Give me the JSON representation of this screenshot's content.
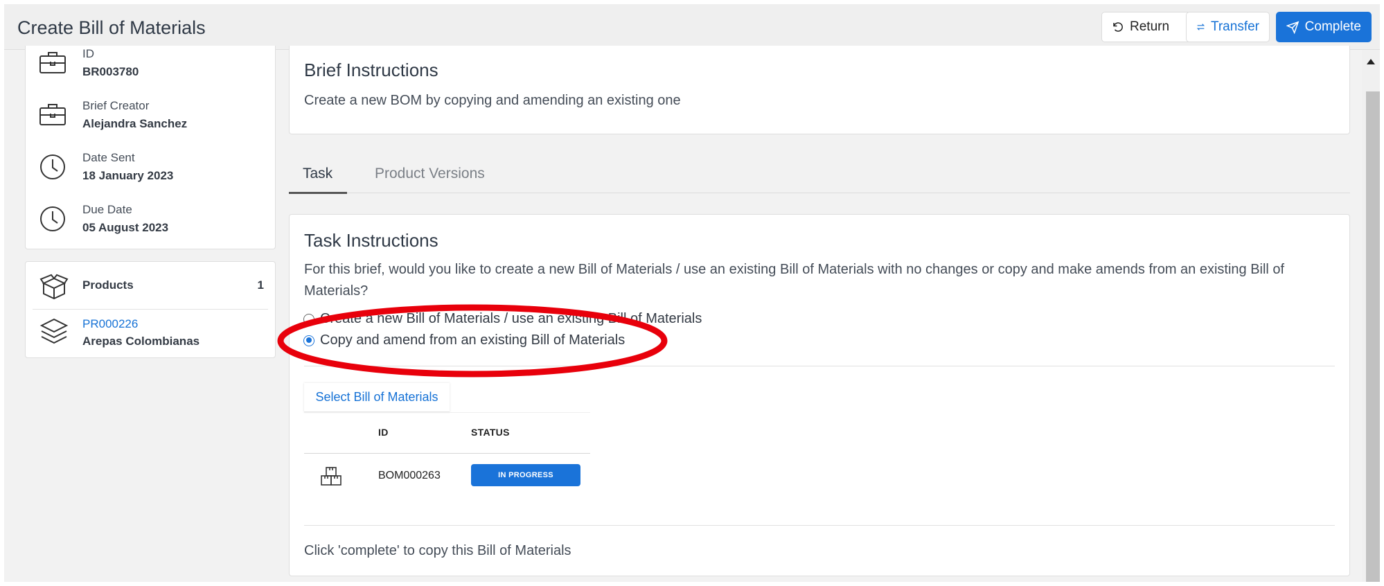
{
  "header": {
    "title": "Create Bill of Materials",
    "return_label": "Return",
    "transfer_label": "Transfer",
    "complete_label": "Complete"
  },
  "info": {
    "id_label": "ID",
    "id_value": "BR003780",
    "creator_label": "Brief Creator",
    "creator_value": "Alejandra Sanchez",
    "date_sent_label": "Date Sent",
    "date_sent_value": "18 January 2023",
    "due_date_label": "Due Date",
    "due_date_value": "05 August 2023"
  },
  "products": {
    "label": "Products",
    "count": "1",
    "items": [
      {
        "id": "PR000226",
        "name": "Arepas Colombianas"
      }
    ]
  },
  "brief": {
    "title": "Brief Instructions",
    "text": "Create a new BOM by copying and amending an existing one"
  },
  "tabs": [
    {
      "label": "Task",
      "active": true
    },
    {
      "label": "Product Versions",
      "active": false
    }
  ],
  "task": {
    "title": "Task Instructions",
    "description": "For this brief, would you like to create a new Bill of Materials / use an existing Bill of Materials with no changes or copy and make amends from an existing Bill of Materials?",
    "options": [
      {
        "label": "Create a new Bill of Materials / use an existing Bill of Materials",
        "checked": false
      },
      {
        "label": "Copy and amend from an existing Bill of Materials",
        "checked": true
      }
    ],
    "select_label": "Select Bill of Materials",
    "table": {
      "columns": [
        "ID",
        "STATUS"
      ],
      "rows": [
        {
          "id": "BOM000263",
          "status": "IN PROGRESS"
        }
      ]
    },
    "footer": "Click 'complete' to copy this Bill of Materials"
  },
  "colors": {
    "accent": "#1a73d9",
    "link": "#1672d6",
    "annotation": "#e8000b"
  },
  "icons": {
    "return": "undo-icon",
    "transfer": "transfer-arrows-icon",
    "complete": "send-icon",
    "id": "briefcase-icon",
    "creator": "briefcase-icon",
    "date_sent": "clock-icon",
    "due_date": "clock-icon",
    "products": "open-box-icon",
    "product_item": "layers-icon",
    "bom_row": "boxes-icon"
  }
}
